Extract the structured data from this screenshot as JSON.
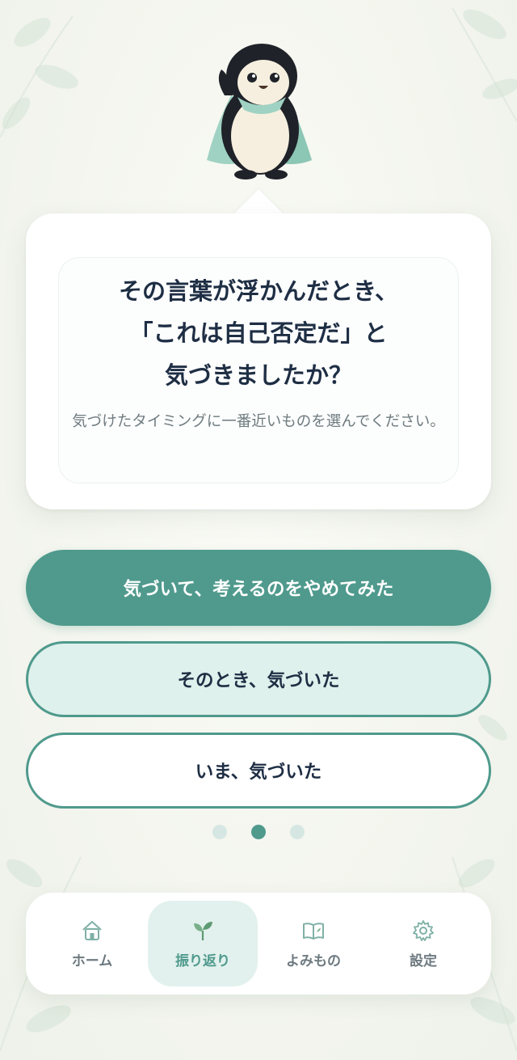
{
  "question": {
    "lines": [
      "その言葉が浮かんだとき、",
      "「これは自己否定だ」と",
      "気づきましたか？"
    ],
    "hint": "気づけたタイミングに一番近いものを選んでください。"
  },
  "options": [
    {
      "label": "気づいて、考えるのをやめてみた",
      "selected": true
    },
    {
      "label": "そのとき、気づいた",
      "selected": false
    },
    {
      "label": "いま、気づいた",
      "selected": false
    }
  ],
  "pager": {
    "total": 3,
    "current": 2
  },
  "nav": {
    "items": [
      {
        "label": "ホーム",
        "icon": "home-icon",
        "active": false
      },
      {
        "label": "振り返り",
        "icon": "sprout-icon",
        "active": true
      },
      {
        "label": "よみもの",
        "icon": "book-icon",
        "active": false
      },
      {
        "label": "設定",
        "icon": "gear-icon",
        "active": false
      }
    ]
  },
  "colors": {
    "accent": "#4f9a8d",
    "accent_light": "#def1ec",
    "text_dark": "#1e2e44",
    "text_muted": "#6f7c80"
  }
}
